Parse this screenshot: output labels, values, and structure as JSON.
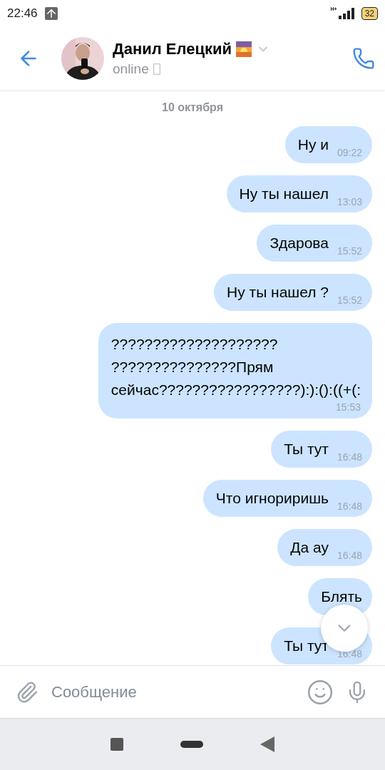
{
  "status_bar": {
    "time": "22:46",
    "network": "H+",
    "battery": "32"
  },
  "header": {
    "name": "Данил Елецкий",
    "status": "online"
  },
  "date_separator": "10 октября",
  "messages": [
    {
      "text": "Ну и",
      "time": "09:22"
    },
    {
      "text": "Ну ты нашел",
      "time": "13:03"
    },
    {
      "text": "Здарова",
      "time": "15:52"
    },
    {
      "text": "Ну ты нашел ?",
      "time": "15:52"
    },
    {
      "text": "????????????????????\n???????????????Прям\nсейчас?????????????????):):():((+(:",
      "time": "15:53"
    },
    {
      "text": "Ты тут",
      "time": "16:48"
    },
    {
      "text": "Что игнориришь",
      "time": "16:48"
    },
    {
      "text": "Да ау",
      "time": "16:48"
    },
    {
      "text": "Блять"
    },
    {
      "text": "Ты тут",
      "time": "16:48"
    }
  ],
  "composer": {
    "placeholder": "Сообщение"
  }
}
